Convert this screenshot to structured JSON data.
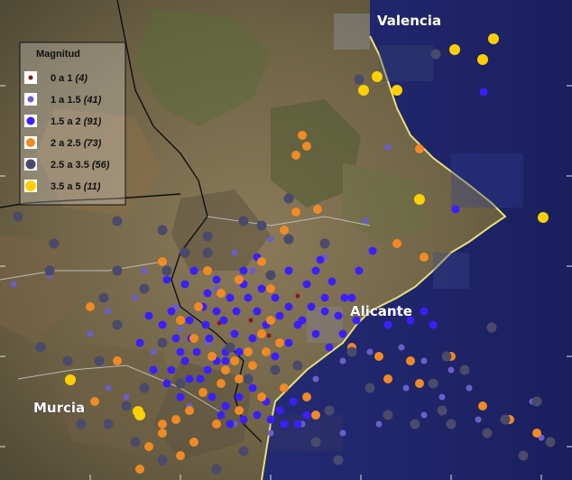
{
  "map": {
    "cities": [
      {
        "name": "Valencia",
        "x": 418,
        "y": 28
      },
      {
        "name": "Alicante",
        "x": 388,
        "y": 350
      },
      {
        "name": "Murcia",
        "x": 37,
        "y": 457
      }
    ]
  },
  "legend": {
    "title": "Magnitud",
    "items": [
      {
        "label": "0 a  1",
        "count": "(4)",
        "color": "#8b1a1a",
        "r": 2.5
      },
      {
        "label": "1 a  1.5",
        "count": "(41)",
        "color": "#6a5fc8",
        "r": 3.5
      },
      {
        "label": "1.5 a  2",
        "count": "(91)",
        "color": "#3b1fff",
        "r": 4.5
      },
      {
        "label": "2 a  2.5",
        "count": "(73)",
        "color": "#f08a24",
        "r": 5
      },
      {
        "label": "2.5 a  3.5",
        "count": "(56)",
        "color": "#4a4a6a",
        "r": 5.5
      },
      {
        "label": "3.5 a  5",
        "count": "(11)",
        "color": "#ffd000",
        "r": 6
      }
    ]
  },
  "chart_data": {
    "type": "scatter",
    "series": [
      {
        "legend_index": 0,
        "points": [
          [
            243,
            358
          ],
          [
            298,
            372
          ],
          [
            330,
            328
          ],
          [
            278,
            355
          ]
        ]
      },
      {
        "legend_index": 1,
        "points": [
          [
            483,
            60
          ],
          [
            430,
            163
          ],
          [
            405,
            245
          ],
          [
            360,
            285
          ],
          [
            300,
            265
          ],
          [
            260,
            280
          ],
          [
            230,
            300
          ],
          [
            195,
            340
          ],
          [
            150,
            330
          ],
          [
            120,
            345
          ],
          [
            100,
            370
          ],
          [
            170,
            390
          ],
          [
            120,
            430
          ],
          [
            210,
            450
          ],
          [
            260,
            470
          ],
          [
            300,
            480
          ],
          [
            350,
            420
          ],
          [
            380,
            400
          ],
          [
            410,
            390
          ],
          [
            445,
            385
          ],
          [
            470,
            400
          ],
          [
            500,
            410
          ],
          [
            520,
            430
          ],
          [
            490,
            440
          ],
          [
            450,
            430
          ],
          [
            545,
            365
          ],
          [
            590,
            445
          ],
          [
            600,
            485
          ],
          [
            530,
            465
          ],
          [
            470,
            460
          ],
          [
            420,
            470
          ],
          [
            380,
            480
          ],
          [
            335,
            470
          ],
          [
            280,
            300
          ],
          [
            240,
            320
          ],
          [
            200,
            365
          ],
          [
            230,
            380
          ],
          [
            15,
            315
          ],
          [
            55,
            305
          ],
          [
            160,
            300
          ],
          [
            140,
            440
          ]
        ]
      },
      {
        "legend_index": 2,
        "points": [
          [
            536,
            102
          ],
          [
            505,
            232
          ],
          [
            465,
            221
          ],
          [
            413,
            278
          ],
          [
            398,
            300
          ],
          [
            382,
            330
          ],
          [
            368,
            312
          ],
          [
            355,
            288
          ],
          [
            340,
            315
          ],
          [
            320,
            300
          ],
          [
            300,
            305
          ],
          [
            285,
            285
          ],
          [
            270,
            300
          ],
          [
            255,
            330
          ],
          [
            240,
            345
          ],
          [
            228,
            360
          ],
          [
            212,
            375
          ],
          [
            200,
            390
          ],
          [
            190,
            410
          ],
          [
            210,
            420
          ],
          [
            230,
            410
          ],
          [
            250,
            400
          ],
          [
            265,
            390
          ],
          [
            280,
            375
          ],
          [
            260,
            370
          ],
          [
            248,
            355
          ],
          [
            232,
            375
          ],
          [
            218,
            390
          ],
          [
            205,
            400
          ],
          [
            195,
            375
          ],
          [
            210,
            355
          ],
          [
            225,
            340
          ],
          [
            240,
            310
          ],
          [
            270,
            315
          ],
          [
            290,
            320
          ],
          [
            305,
            330
          ],
          [
            320,
            340
          ],
          [
            335,
            355
          ],
          [
            350,
            370
          ],
          [
            365,
            385
          ],
          [
            380,
            370
          ],
          [
            375,
            350
          ],
          [
            390,
            330
          ],
          [
            360,
            330
          ],
          [
            345,
            340
          ],
          [
            330,
            360
          ],
          [
            310,
            350
          ],
          [
            295,
            360
          ],
          [
            285,
            345
          ],
          [
            275,
            330
          ],
          [
            262,
            345
          ],
          [
            250,
            390
          ],
          [
            240,
            400
          ],
          [
            222,
            420
          ],
          [
            235,
            440
          ],
          [
            250,
            450
          ],
          [
            265,
            440
          ],
          [
            280,
            430
          ],
          [
            295,
            445
          ],
          [
            310,
            455
          ],
          [
            325,
            445
          ],
          [
            340,
            460
          ],
          [
            330,
            470
          ],
          [
            315,
            470
          ],
          [
            300,
            465
          ],
          [
            285,
            460
          ],
          [
            270,
            465
          ],
          [
            255,
            470
          ],
          [
            245,
            460
          ],
          [
            200,
            440
          ],
          [
            185,
            425
          ],
          [
            170,
            410
          ],
          [
            155,
            380
          ],
          [
            165,
            350
          ],
          [
            180,
            360
          ],
          [
            190,
            345
          ],
          [
            205,
            315
          ],
          [
            215,
            300
          ],
          [
            185,
            310
          ],
          [
            230,
            325
          ],
          [
            350,
            300
          ],
          [
            360,
            345
          ],
          [
            395,
            355
          ],
          [
            430,
            360
          ],
          [
            455,
            355
          ],
          [
            470,
            345
          ],
          [
            480,
            360
          ],
          [
            440,
            345
          ],
          [
            320,
            380
          ],
          [
            305,
            395
          ]
        ]
      },
      {
        "legend_index": 3,
        "points": [
          [
            335,
            150
          ],
          [
            340,
            162
          ],
          [
            328,
            172
          ],
          [
            465,
            165
          ],
          [
            440,
            270
          ],
          [
            470,
            285
          ],
          [
            352,
            232
          ],
          [
            328,
            235
          ],
          [
            315,
            255
          ],
          [
            290,
            290
          ],
          [
            265,
            310
          ],
          [
            245,
            325
          ],
          [
            220,
            340
          ],
          [
            200,
            355
          ],
          [
            215,
            375
          ],
          [
            235,
            395
          ],
          [
            250,
            410
          ],
          [
            265,
            420
          ],
          [
            280,
            405
          ],
          [
            295,
            390
          ],
          [
            310,
            380
          ],
          [
            300,
            355
          ],
          [
            290,
            370
          ],
          [
            275,
            390
          ],
          [
            260,
            400
          ],
          [
            245,
            425
          ],
          [
            225,
            435
          ],
          [
            210,
            455
          ],
          [
            195,
            465
          ],
          [
            180,
            480
          ],
          [
            165,
            495
          ],
          [
            155,
            520
          ],
          [
            200,
            505
          ],
          [
            215,
            490
          ],
          [
            240,
            470
          ],
          [
            265,
            455
          ],
          [
            290,
            440
          ],
          [
            315,
            430
          ],
          [
            340,
            440
          ],
          [
            350,
            460
          ],
          [
            390,
            385
          ],
          [
            420,
            395
          ],
          [
            455,
            400
          ],
          [
            465,
            425
          ],
          [
            430,
            420
          ],
          [
            500,
            395
          ],
          [
            535,
            450
          ],
          [
            565,
            465
          ],
          [
            595,
            480
          ],
          [
            100,
            340
          ],
          [
            180,
            290
          ],
          [
            130,
            400
          ],
          [
            105,
            445
          ],
          [
            180,
            470
          ],
          [
            230,
            300
          ],
          [
            300,
            320
          ]
        ]
      },
      {
        "legend_index": 4,
        "points": [
          [
            483,
            60
          ],
          [
            398,
            88
          ],
          [
            360,
            270
          ],
          [
            320,
            220
          ],
          [
            270,
            245
          ],
          [
            230,
            262
          ],
          [
            180,
            255
          ],
          [
            130,
            245
          ],
          [
            60,
            270
          ],
          [
            20,
            240
          ],
          [
            55,
            300
          ],
          [
            160,
            320
          ],
          [
            130,
            360
          ],
          [
            180,
            380
          ],
          [
            200,
            425
          ],
          [
            110,
            400
          ],
          [
            140,
            450
          ],
          [
            120,
            470
          ],
          [
            90,
            470
          ],
          [
            545,
            363
          ],
          [
            495,
            395
          ],
          [
            480,
            425
          ],
          [
            515,
            410
          ],
          [
            490,
            455
          ],
          [
            595,
            445
          ],
          [
            560,
            465
          ],
          [
            390,
            390
          ],
          [
            410,
            430
          ],
          [
            365,
            455
          ],
          [
            350,
            490
          ],
          [
            375,
            510
          ],
          [
            270,
            500
          ],
          [
            240,
            520
          ],
          [
            180,
            510
          ],
          [
            150,
            490
          ],
          [
            160,
            430
          ],
          [
            75,
            400
          ],
          [
            45,
            385
          ],
          [
            320,
            265
          ],
          [
            300,
            305
          ],
          [
            185,
            300
          ],
          [
            205,
            280
          ],
          [
            230,
            280
          ],
          [
            290,
            250
          ],
          [
            130,
            300
          ],
          [
            115,
            330
          ],
          [
            255,
            385
          ],
          [
            275,
            420
          ],
          [
            305,
            410
          ],
          [
            330,
            405
          ],
          [
            430,
            460
          ],
          [
            460,
            470
          ],
          [
            500,
            470
          ],
          [
            540,
            480
          ],
          [
            580,
            505
          ],
          [
            610,
            490
          ]
        ]
      },
      {
        "legend_index": 5,
        "points": [
          [
            547,
            43
          ],
          [
            504,
            55
          ],
          [
            535,
            66
          ],
          [
            440,
            100
          ],
          [
            403,
            100
          ],
          [
            465,
            221
          ],
          [
            602,
            241
          ],
          [
            78,
            421
          ],
          [
            153,
            456
          ],
          [
            155,
            460
          ],
          [
            418,
            85
          ]
        ]
      }
    ]
  }
}
